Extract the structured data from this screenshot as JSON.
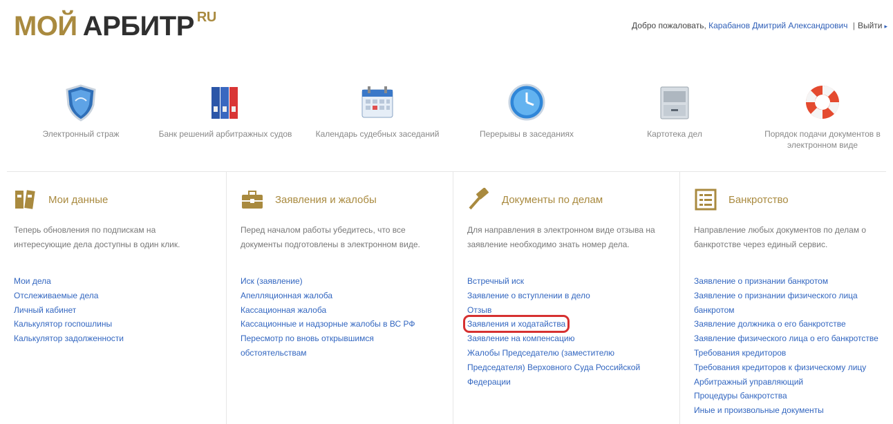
{
  "header": {
    "logo_part1": "МОЙ",
    "logo_part2": "АРБИТР",
    "logo_part3": "RU",
    "welcome": "Добро пожаловать,",
    "user_name": "Карабанов Дмитрий Александрович",
    "separator": "|",
    "logout": "Выйти"
  },
  "services": [
    {
      "icon": "shield-icon",
      "label": "Электронный страж"
    },
    {
      "icon": "binders-icon",
      "label": "Банк решений арбитражных судов"
    },
    {
      "icon": "calendar-icon",
      "label": "Календарь судебных заседаний"
    },
    {
      "icon": "clock-icon",
      "label": "Перерывы в заседаниях"
    },
    {
      "icon": "file-cabinet-icon",
      "label": "Картотека дел"
    },
    {
      "icon": "lifebuoy-icon",
      "label": "Порядок подачи документов в электронном виде"
    }
  ],
  "columns": [
    {
      "title": "Мои данные",
      "icon": "folders-icon",
      "desc": "Теперь обновления по подпискам на интересующие дела доступны в один клик.",
      "links": [
        "Мои дела",
        "Отслеживаемые дела",
        "Личный кабинет",
        "Калькулятор госпошлины",
        "Калькулятор задолженности"
      ]
    },
    {
      "title": "Заявления и жалобы",
      "icon": "briefcase-icon",
      "desc": "Перед началом работы убедитесь, что все документы подготовлены в электронном виде.",
      "links": [
        "Иск (заявление)",
        "Апелляционная жалоба",
        "Кассационная жалоба",
        "Кассационные и надзорные жалобы в ВС РФ",
        "Пересмотр по вновь открывшимся обстоятельствам"
      ]
    },
    {
      "title": "Документы по делам",
      "icon": "gavel-icon",
      "desc": "Для направления в электронном виде отзыва на заявление необходимо знать номер дела.",
      "links": [
        "Встречный иск",
        "Заявление о вступлении в дело",
        "Отзыв",
        "Заявления и ходатайства",
        "Заявление на компенсацию",
        "Жалобы Председателю (заместителю Председателя) Верховного Суда Российской Федерации"
      ],
      "highlighted_link": "Заявления и ходатайства"
    },
    {
      "title": "Банкротство",
      "icon": "checklist-icon",
      "desc": "Направление любых документов по делам о банкротстве через единый сервис.",
      "links": [
        "Заявление о признании банкротом",
        "Заявление о признании физического лица банкротом",
        "Заявление должника о его банкротстве",
        "Заявление физического лица о его банкротстве",
        "Требования кредиторов",
        "Требования кредиторов к физическому лицу",
        "Арбитражный управляющий",
        "Процедуры банкротства",
        "Иные и произвольные документы"
      ]
    }
  ],
  "colors": {
    "accent": "#a98a3f",
    "link": "#3266c0",
    "highlight": "#d63030"
  }
}
